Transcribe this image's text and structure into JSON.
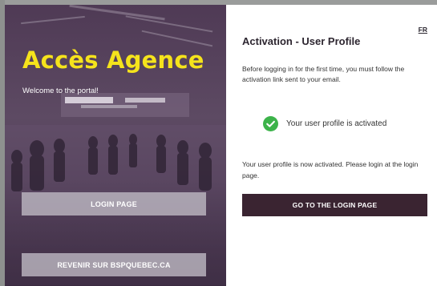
{
  "hero": {
    "title": "Accès Agence",
    "welcome": "Welcome to the portal!",
    "login_button": "LOGIN PAGE",
    "revenir_button": "REVENIR SUR BSPQUEBEC.CA"
  },
  "panel": {
    "lang_toggle": "FR",
    "title": "Activation - User Profile",
    "intro": "Before logging in for the first time, you must follow the activation link sent to your email.",
    "status_text": "Your user profile is activated",
    "activated_text": "Your user profile is now activated. Please login at the login page.",
    "go_button": "GO TO THE LOGIN PAGE"
  },
  "colors": {
    "title_yellow": "#f5e31c",
    "brand_dark": "#3a2431",
    "success_green": "#3cb34a",
    "hero_overlay": "#4f3a55"
  },
  "icons": {
    "status": "check-circle-icon"
  }
}
